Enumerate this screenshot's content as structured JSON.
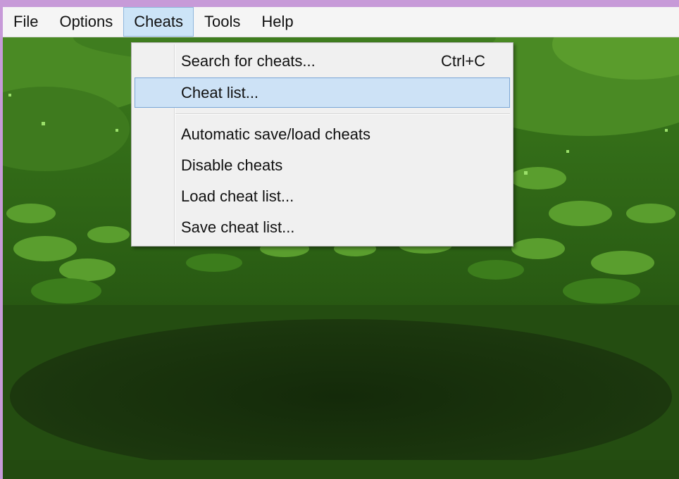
{
  "menubar": {
    "items": [
      {
        "label": "File"
      },
      {
        "label": "Options"
      },
      {
        "label": "Cheats"
      },
      {
        "label": "Tools"
      },
      {
        "label": "Help"
      }
    ],
    "active_item": "Cheats"
  },
  "cheats_menu": {
    "items": [
      {
        "label": "Search for cheats...",
        "shortcut": "Ctrl+C"
      },
      {
        "label": "Cheat list...",
        "shortcut": ""
      },
      {
        "label": "Automatic save/load cheats",
        "shortcut": ""
      },
      {
        "label": "Disable cheats",
        "shortcut": ""
      },
      {
        "label": "Load cheat list...",
        "shortcut": ""
      },
      {
        "label": "Save cheat list...",
        "shortcut": ""
      }
    ],
    "highlighted_item": "Cheat list..."
  },
  "colors": {
    "menu_highlight": "#cde2f6",
    "menu_highlight_border": "#7aa6d6",
    "window_border": "#c79ad8",
    "forest_dark": "#15280b",
    "forest_mid": "#2e5c16",
    "forest_light": "#4f8f28"
  }
}
